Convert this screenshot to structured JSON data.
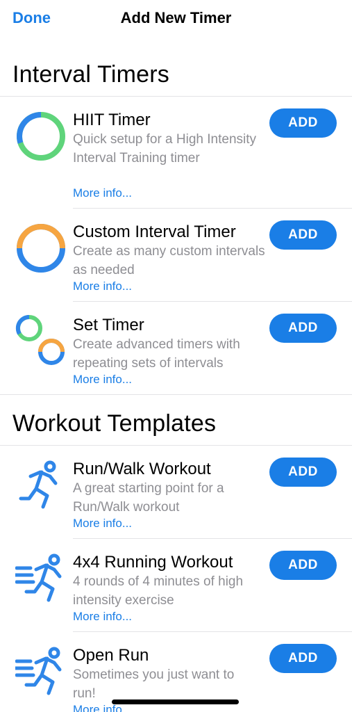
{
  "nav": {
    "done_label": "Done",
    "title": "Add New Timer"
  },
  "sections": {
    "interval": {
      "title": "Interval Timers",
      "items": [
        {
          "title": "HIIT Timer",
          "description": "Quick setup for a High Intensity Interval Training timer",
          "more": "More info...",
          "button": "ADD",
          "icon": "hiit-ring-icon"
        },
        {
          "title": "Custom Interval Timer",
          "description": "Create as many custom intervals as needed",
          "more": "More info...",
          "button": "ADD",
          "icon": "custom-interval-ring-icon"
        },
        {
          "title": "Set Timer",
          "description": "Create advanced timers with repeating sets of intervals",
          "more": "More info...",
          "button": "ADD",
          "icon": "set-timer-rings-icon"
        }
      ]
    },
    "workout": {
      "title": "Workout Templates",
      "items": [
        {
          "title": "Run/Walk Workout",
          "description": "A great starting point for a Run/Walk workout",
          "more": "More info...",
          "button": "ADD",
          "icon": "runner-icon"
        },
        {
          "title": "4x4 Running Workout",
          "description": "4 rounds of 4 minutes of high intensity exercise",
          "more": "More info...",
          "button": "ADD",
          "icon": "fast-runner-icon"
        },
        {
          "title": "Open Run",
          "description": "Sometimes you just want to run!",
          "more": "More info...",
          "button": "ADD",
          "icon": "fast-runner-icon"
        }
      ]
    }
  },
  "colors": {
    "accent": "#1a7ee6",
    "ring_blue": "#2f86e8",
    "ring_green": "#5fd47b",
    "ring_orange": "#f6a541",
    "secondary_text": "#8e8e93",
    "separator": "#e3e3e6"
  }
}
